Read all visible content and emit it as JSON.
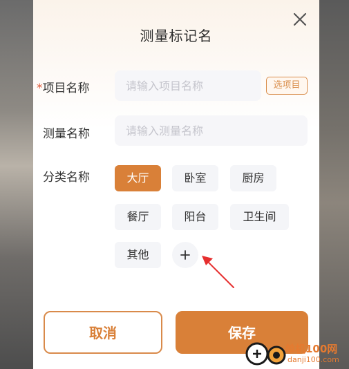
{
  "dialog": {
    "title": "测量标记名",
    "fields": {
      "project": {
        "required_mark": "*",
        "label": "项目名称",
        "placeholder": "请输入项目名称",
        "pick_button": "选项目"
      },
      "measure": {
        "label": "测量名称",
        "placeholder": "请输入测量名称"
      },
      "category": {
        "label": "分类名称",
        "chips": [
          "大厅",
          "卧室",
          "厨房",
          "餐厅",
          "阳台",
          "卫生间",
          "其他"
        ],
        "selected": "大厅"
      }
    },
    "buttons": {
      "cancel": "取消",
      "save": "保存"
    }
  },
  "icons": {
    "close": "close-icon",
    "add": "plus-icon",
    "annotation": "red-arrow-icon"
  },
  "colors": {
    "accent": "#d98038",
    "required": "#e05a3a",
    "annotation": "#e62e2e"
  },
  "watermark": {
    "name": "单机100网",
    "url": "danji100.com"
  }
}
